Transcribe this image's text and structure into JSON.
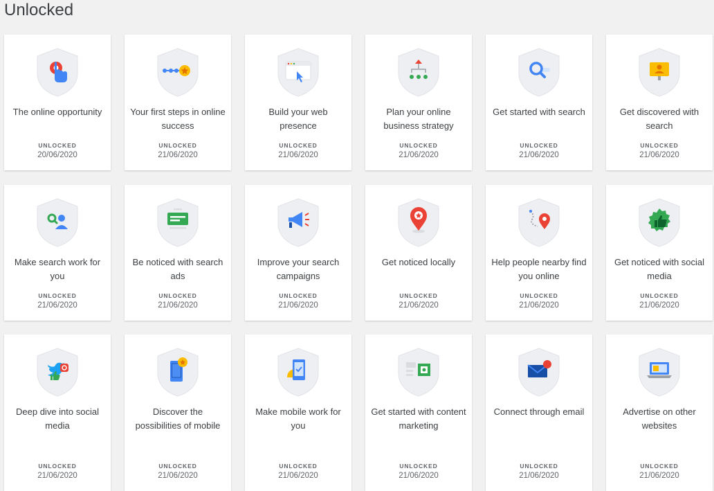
{
  "page": {
    "title": "Unlocked"
  },
  "status_label": "UNLOCKED",
  "badges": [
    {
      "title": "The online opportunity",
      "date": "20/06/2020",
      "icon": "touch-target-icon"
    },
    {
      "title": "Your first steps in online success",
      "date": "21/06/2020",
      "icon": "path-star-icon"
    },
    {
      "title": "Build your web presence",
      "date": "21/06/2020",
      "icon": "browser-cursor-icon"
    },
    {
      "title": "Plan your online business strategy",
      "date": "21/06/2020",
      "icon": "org-chart-icon"
    },
    {
      "title": "Get started with search",
      "date": "21/06/2020",
      "icon": "magnifier-icon"
    },
    {
      "title": "Get discovered with search",
      "date": "21/06/2020",
      "icon": "sign-person-icon"
    },
    {
      "title": "Make search work for you",
      "date": "21/06/2020",
      "icon": "search-person-icon"
    },
    {
      "title": "Be noticed with search ads",
      "date": "21/06/2020",
      "icon": "ad-card-icon"
    },
    {
      "title": "Improve your search campaigns",
      "date": "21/06/2020",
      "icon": "megaphone-icon"
    },
    {
      "title": "Get noticed locally",
      "date": "21/06/2020",
      "icon": "map-pin-star-icon"
    },
    {
      "title": "Help people nearby find you online",
      "date": "21/06/2020",
      "icon": "route-pin-icon"
    },
    {
      "title": "Get noticed with social media",
      "date": "21/06/2020",
      "icon": "thumbs-up-seal-icon"
    },
    {
      "title": "Deep dive into social media",
      "date": "21/06/2020",
      "icon": "social-bird-icon"
    },
    {
      "title": "Discover the possibilities of mobile",
      "date": "21/06/2020",
      "icon": "phone-star-icon"
    },
    {
      "title": "Make mobile work for you",
      "date": "21/06/2020",
      "icon": "phone-check-icon"
    },
    {
      "title": "Get started with content marketing",
      "date": "21/06/2020",
      "icon": "content-layout-icon"
    },
    {
      "title": "Connect through email",
      "date": "21/06/2020",
      "icon": "envelope-icon"
    },
    {
      "title": "Advertise on other websites",
      "date": "21/06/2020",
      "icon": "laptop-ad-icon"
    }
  ],
  "colors": {
    "blue": "#4285f4",
    "red": "#ea4335",
    "yellow": "#fbbc04",
    "green": "#34a853",
    "shield": "#eeeff2"
  }
}
